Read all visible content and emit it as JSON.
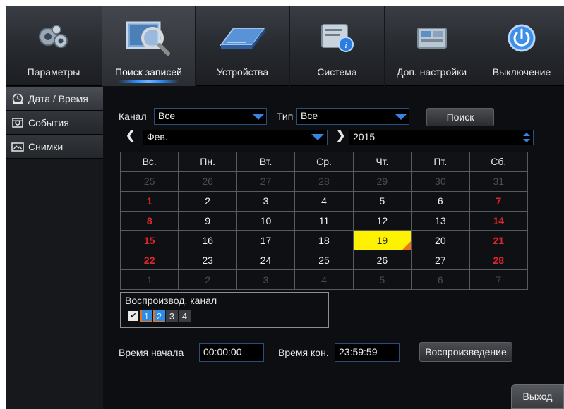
{
  "nav": {
    "items": [
      {
        "label": "Параметры",
        "icon": "gears-icon"
      },
      {
        "label": "Поиск записей",
        "icon": "search-records-icon"
      },
      {
        "label": "Устройства",
        "icon": "hard-drive-icon"
      },
      {
        "label": "Система",
        "icon": "system-info-icon"
      },
      {
        "label": "Доп. настройки",
        "icon": "advanced-settings-icon"
      },
      {
        "label": "Выключение",
        "icon": "power-icon"
      }
    ],
    "active_index": 1
  },
  "sidebar": {
    "items": [
      {
        "label": "Дата / Время",
        "icon": "calendar-clock-icon"
      },
      {
        "label": "События",
        "icon": "events-icon"
      },
      {
        "label": "Снимки",
        "icon": "snapshots-icon"
      }
    ]
  },
  "filters": {
    "channel_label": "Канал",
    "channel_value": "Все",
    "type_label": "Тип",
    "type_value": "Все",
    "search_button": "Поиск"
  },
  "month_nav": {
    "prev": "❮",
    "next": "❯",
    "month": "Фев.",
    "year": "2015"
  },
  "calendar": {
    "weekdays": [
      "Вс.",
      "Пн.",
      "Вт.",
      "Ср.",
      "Чт.",
      "Пт.",
      "Сб."
    ],
    "weeks": [
      [
        "25",
        "26",
        "27",
        "28",
        "29",
        "30",
        "31"
      ],
      [
        "1",
        "2",
        "3",
        "4",
        "5",
        "6",
        "7"
      ],
      [
        "8",
        "9",
        "10",
        "11",
        "12",
        "13",
        "14"
      ],
      [
        "15",
        "16",
        "17",
        "18",
        "19",
        "20",
        "21"
      ],
      [
        "22",
        "23",
        "24",
        "25",
        "26",
        "27",
        "28"
      ],
      [
        "1",
        "2",
        "3",
        "4",
        "5",
        "6",
        "7"
      ]
    ],
    "day_with_record": "19",
    "colors": {
      "record": "#fff200",
      "weekend": "#e0262a",
      "other_month": "#4a4d52"
    }
  },
  "playback_channels": {
    "title": "Воспроизвод. канал",
    "all_checked_mark": "✔",
    "channels": [
      {
        "num": "1",
        "selected": true
      },
      {
        "num": "2",
        "selected": true
      },
      {
        "num": "3",
        "selected": false
      },
      {
        "num": "4",
        "selected": false
      }
    ]
  },
  "time": {
    "start_label": "Время начала",
    "start_value": "00:00:00",
    "end_label": "Время кон.",
    "end_value": "23:59:59",
    "play_button": "Воспроизведение"
  },
  "exit_button": "Выход",
  "colors": {
    "accent": "#2e8cff",
    "field_border": "#2a4d7a"
  }
}
